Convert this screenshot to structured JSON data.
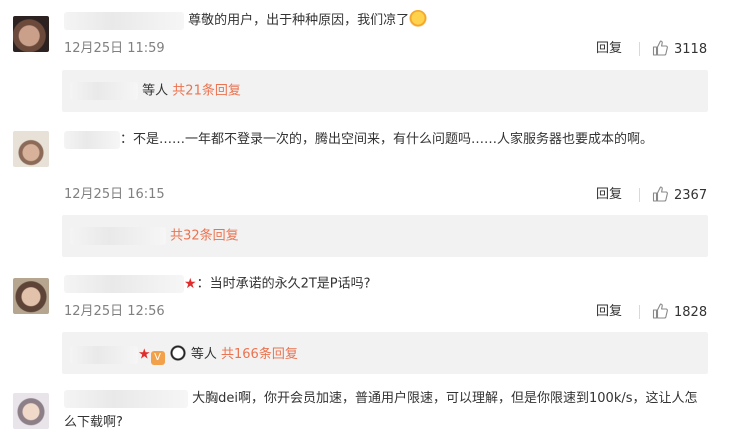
{
  "comments": [
    {
      "text": "尊敬的用户，出于种种原因，我们凉了",
      "time": "12月25日 11:59",
      "reply_label": "回复",
      "likes": "3118",
      "replies_suffix": "等人",
      "replies_link": "共21条回复"
    },
    {
      "text": "：不是……一年都不登录一次的，腾出空间来，有什么问题吗……人家服务器也要成本的啊。",
      "time": "12月25日 16:15",
      "reply_label": "回复",
      "likes": "2367",
      "replies_link": "共32条回复"
    },
    {
      "text": "：当时承诺的永久2T是P话吗?",
      "time": "12月25日 12:56",
      "reply_label": "回复",
      "likes": "1828",
      "replies_suffix": "等人",
      "replies_link": "共166条回复"
    },
    {
      "text": "大胸dei啊，你开会员加速，普通用户限速，可以理解，但是你限速到100k/s，这让人怎么下载啊?"
    }
  ],
  "icons": {
    "like": "thumbs-up-icon",
    "star": "red-star-icon",
    "emoji_cool": "cool-face-emoji-icon",
    "emoji_panda": "panda-emoji-icon",
    "badge": "vip-badge-icon"
  },
  "colors": {
    "link": "#eb7350",
    "meta": "#808080",
    "reply_bg": "#f2f2f2"
  }
}
